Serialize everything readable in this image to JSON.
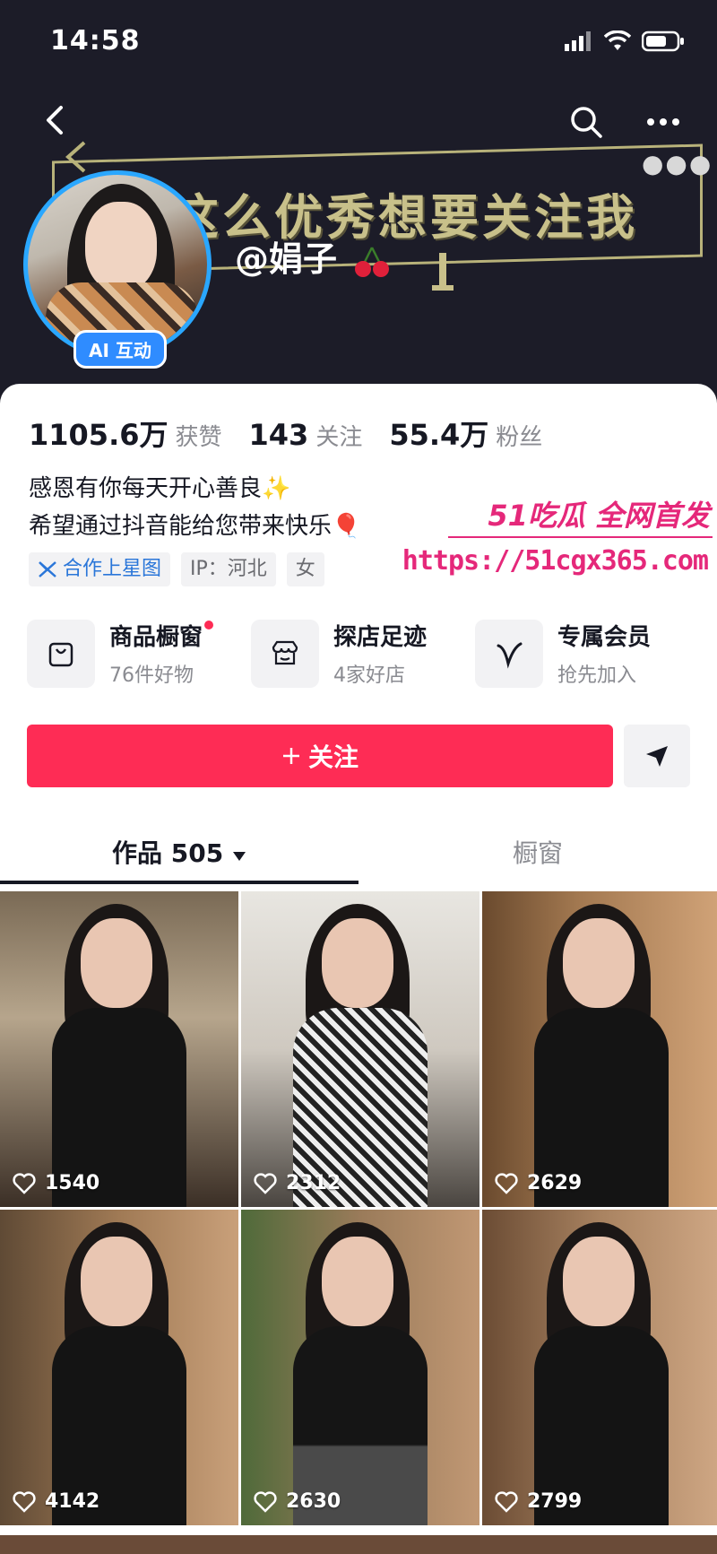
{
  "status": {
    "time": "14:58"
  },
  "banner": {
    "text": "这么优秀想要关注我"
  },
  "profile": {
    "username": "@娟子",
    "ai_badge": "AI 互动"
  },
  "stats": [
    {
      "num": "1105.6万",
      "label": "获赞"
    },
    {
      "num": "143",
      "label": "关注"
    },
    {
      "num": "55.4万",
      "label": "粉丝"
    }
  ],
  "bio": [
    "感恩有你每天开心善良✨",
    "希望通过抖音能给您带来快乐🎈"
  ],
  "tags": {
    "star": "合作上星图",
    "ip": "IP：河北",
    "gender": "女"
  },
  "watermark": {
    "logo": "51吃瓜 全网首发",
    "url": "https://51cgx365.com"
  },
  "features": [
    {
      "title": "商品橱窗",
      "sub": "76件好物",
      "icon": "bag-icon"
    },
    {
      "title": "探店足迹",
      "sub": "4家好店",
      "icon": "store-icon"
    },
    {
      "title": "专属会员",
      "sub": "抢先加入",
      "icon": "v-icon"
    }
  ],
  "actions": {
    "follow": "关注"
  },
  "tabs": {
    "works": "作品 505",
    "shop": "橱窗"
  },
  "videos": [
    {
      "likes": "1540"
    },
    {
      "likes": "2312"
    },
    {
      "likes": "2629"
    },
    {
      "likes": "4142"
    },
    {
      "likes": "2630"
    },
    {
      "likes": "2799"
    }
  ],
  "colors": {
    "accent": "#fe2c55",
    "header_bg": "#1c1c28",
    "ai_badge": "#2f8cff",
    "watermark": "#e5287a"
  }
}
